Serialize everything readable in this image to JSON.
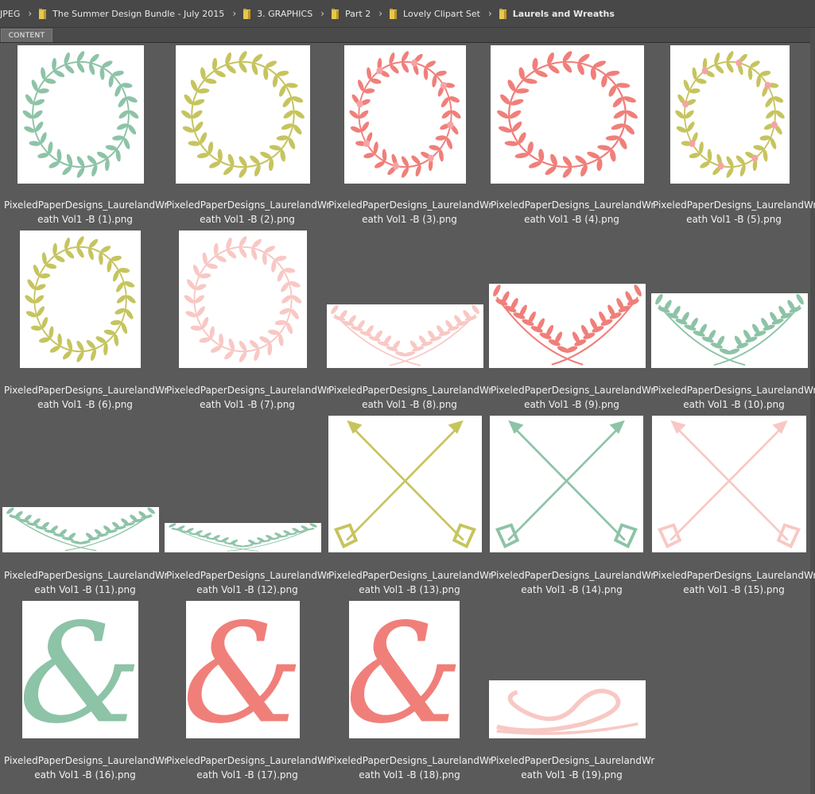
{
  "breadcrumb": {
    "items": [
      {
        "label": "JPEG",
        "folder": false
      },
      {
        "label": "The Summer Design Bundle - July 2015",
        "folder": true
      },
      {
        "label": "3. GRAPHICS",
        "folder": true
      },
      {
        "label": "Part 2",
        "folder": true
      },
      {
        "label": "Lovely Clipart Set",
        "folder": true
      },
      {
        "label": "Laurels and Wreaths",
        "folder": true,
        "current": true
      }
    ]
  },
  "tabs": {
    "content_label": "CONTENT"
  },
  "colors": {
    "mint": "#8dc3a7",
    "olive": "#c6c45e",
    "coral": "#f07f7a",
    "pink": "#f8c8c4",
    "bg": "#5a5a5a"
  },
  "files": [
    {
      "line1": "PixeledPaperDesigns_LaurelandWr",
      "line2": "eath Vol1 -B (1).png",
      "kind": "wreath",
      "color": "mint"
    },
    {
      "line1": "PixeledPaperDesigns_LaurelandWr",
      "line2": "eath Vol1 -B (2).png",
      "kind": "wreath",
      "color": "olive"
    },
    {
      "line1": "PixeledPaperDesigns_LaurelandWr",
      "line2": "eath Vol1 -B (3).png",
      "kind": "wreath-flowers",
      "color": "coral"
    },
    {
      "line1": "PixeledPaperDesigns_LaurelandWr",
      "line2": "eath Vol1 -B (4).png",
      "kind": "wreath",
      "color": "coral"
    },
    {
      "line1": "PixeledPaperDesigns_LaurelandWr",
      "line2": "eath Vol1 -B (5).png",
      "kind": "wreath-flowers",
      "color": "olive"
    },
    {
      "line1": "PixeledPaperDesigns_LaurelandWr",
      "line2": "eath Vol1 -B (6).png",
      "kind": "wreath",
      "color": "olive"
    },
    {
      "line1": "PixeledPaperDesigns_LaurelandWr",
      "line2": "eath Vol1 -B (7).png",
      "kind": "wreath",
      "color": "pink"
    },
    {
      "line1": "PixeledPaperDesigns_LaurelandWr",
      "line2": "eath Vol1 -B (8).png",
      "kind": "laurel",
      "color": "pink"
    },
    {
      "line1": "PixeledPaperDesigns_LaurelandWr",
      "line2": "eath Vol1 -B (9).png",
      "kind": "laurel",
      "color": "coral"
    },
    {
      "line1": "PixeledPaperDesigns_LaurelandWr",
      "line2": "eath Vol1 -B (10).png",
      "kind": "laurel",
      "color": "mint"
    },
    {
      "line1": "PixeledPaperDesigns_LaurelandWr",
      "line2": "eath Vol1 -B (11).png",
      "kind": "laurel",
      "color": "mint"
    },
    {
      "line1": "PixeledPaperDesigns_LaurelandWr",
      "line2": "eath Vol1 -B (12).png",
      "kind": "laurel",
      "color": "mint"
    },
    {
      "line1": "PixeledPaperDesigns_LaurelandWr",
      "line2": "eath Vol1 -B (13).png",
      "kind": "arrows",
      "color": "olive"
    },
    {
      "line1": "PixeledPaperDesigns_LaurelandWr",
      "line2": "eath Vol1 -B (14).png",
      "kind": "arrows",
      "color": "mint"
    },
    {
      "line1": "PixeledPaperDesigns_LaurelandWr",
      "line2": "eath Vol1 -B (15).png",
      "kind": "arrows",
      "color": "pink"
    },
    {
      "line1": "PixeledPaperDesigns_LaurelandWr",
      "line2": "eath Vol1 -B (16).png",
      "kind": "ampersand",
      "color": "mint"
    },
    {
      "line1": "PixeledPaperDesigns_LaurelandWr",
      "line2": "eath Vol1 -B (17).png",
      "kind": "ampersand",
      "color": "coral"
    },
    {
      "line1": "PixeledPaperDesigns_LaurelandWr",
      "line2": "eath Vol1 -B (18).png",
      "kind": "ampersand",
      "color": "coral"
    },
    {
      "line1": "PixeledPaperDesigns_LaurelandWr",
      "line2": "eath Vol1 -B (19).png",
      "kind": "infinity",
      "color": "pink"
    }
  ]
}
